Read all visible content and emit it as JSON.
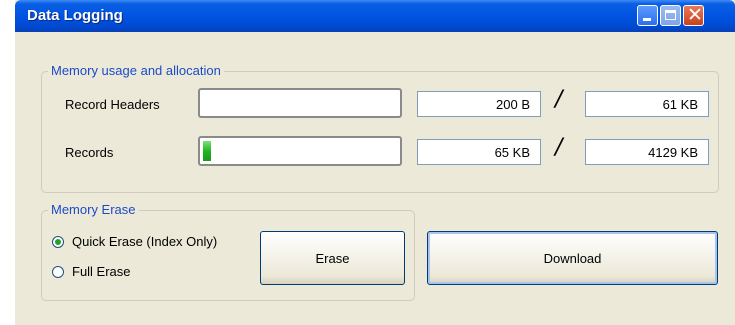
{
  "window": {
    "title": "Data Logging"
  },
  "memory_group": {
    "legend": "Memory usage and allocation",
    "rows": [
      {
        "label": "Record Headers",
        "progress": 0.0,
        "used": "200 B",
        "separator": "/",
        "total": "61 KB"
      },
      {
        "label": "Records",
        "progress": 0.016,
        "used": "65 KB",
        "separator": "/",
        "total": "4129 KB"
      }
    ]
  },
  "erase_group": {
    "legend": "Memory Erase",
    "options": [
      {
        "label": "Quick Erase (Index Only)",
        "selected": true
      },
      {
        "label": "Full Erase",
        "selected": false
      }
    ],
    "erase_button": "Erase"
  },
  "download_button": "Download",
  "colors": {
    "title_bar": "#0054e3",
    "group_legend": "#1b4bc9",
    "progress_fill": "#22b522"
  }
}
